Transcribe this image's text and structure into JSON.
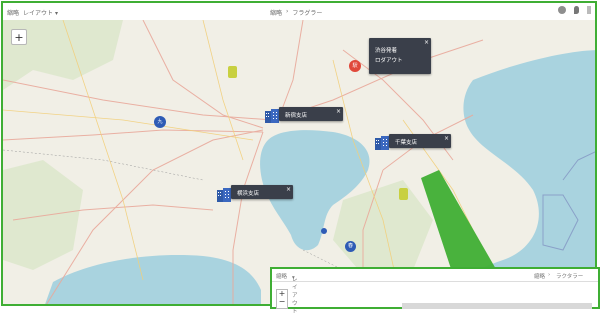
{
  "toolbar": {
    "tab_label": "縮略",
    "layout_label": "レイアウト",
    "layout_caret": "▾",
    "center_label": "縮略",
    "center_sep": "›",
    "center_text": "フラグラー"
  },
  "map": {
    "zoom_in": "+"
  },
  "popups": [
    {
      "title": "渋谷発着",
      "subtitle": "ロダアウト",
      "close": "×"
    },
    {
      "title": "新宿支店",
      "close": "×"
    },
    {
      "title": "千葉支店",
      "close": "×"
    },
    {
      "title": "横浜支店",
      "close": "×"
    }
  ],
  "markers": {
    "red": "駅",
    "blue_left": "九",
    "blue_bottom": "春"
  },
  "inset": {
    "tab_label": "縮略",
    "layout_label": "レイアウト",
    "caret": "▾",
    "right_label": "縮略",
    "right_sep": "›",
    "right_text": "ラクタラー",
    "zoom_in": "+",
    "zoom_out": "−"
  },
  "colors": {
    "frame": "#3fae34",
    "water": "#a9d3df",
    "land": "#f1efe6",
    "popup": "#3a3f4a"
  }
}
